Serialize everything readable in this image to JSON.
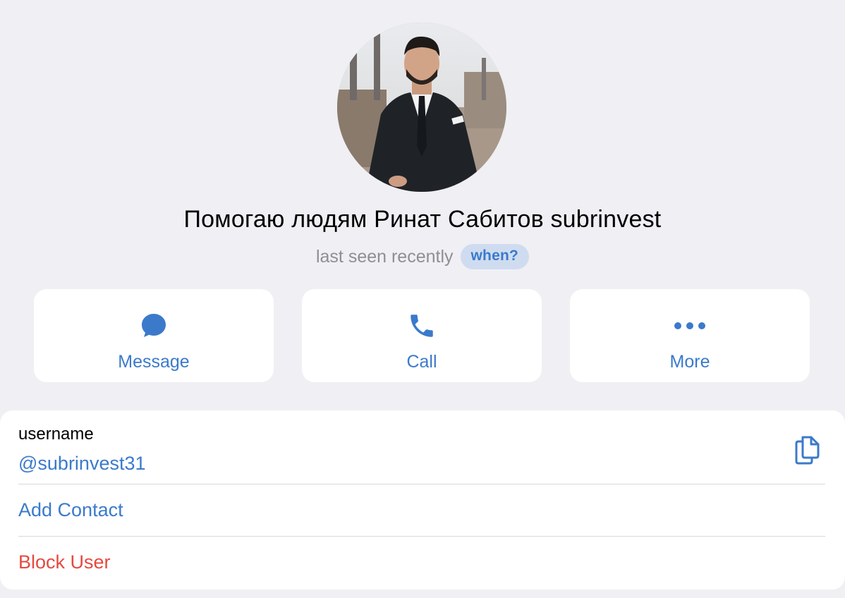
{
  "profile": {
    "name": "Помогаю людям Ринат Сабитов subrinvest",
    "status": "last seen recently",
    "when_label": "when?"
  },
  "actions": [
    {
      "label": "Message",
      "icon": "message-bubble-icon"
    },
    {
      "label": "Call",
      "icon": "phone-icon"
    },
    {
      "label": "More",
      "icon": "more-dots-icon"
    }
  ],
  "info": {
    "username_caption": "username",
    "username_value": "@subrinvest31",
    "copy_icon": "copy-icon",
    "add_contact": "Add Contact",
    "block_user": "Block User"
  },
  "colors": {
    "background": "#efeff4",
    "accent": "#3b7acb",
    "destructive": "#e5493f",
    "secondary_text": "#8e8e93",
    "card": "#ffffff"
  }
}
